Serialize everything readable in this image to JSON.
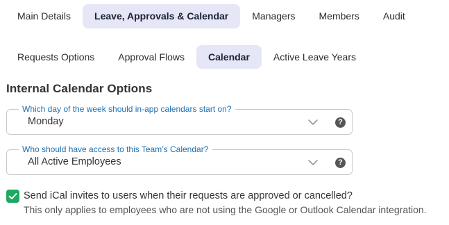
{
  "primary_tabs": [
    {
      "label": "Main Details",
      "active": false
    },
    {
      "label": "Leave, Approvals & Calendar",
      "active": true
    },
    {
      "label": "Managers",
      "active": false
    },
    {
      "label": "Members",
      "active": false
    },
    {
      "label": "Audit",
      "active": false
    }
  ],
  "secondary_tabs": [
    {
      "label": "Requests Options",
      "active": false
    },
    {
      "label": "Approval Flows",
      "active": false
    },
    {
      "label": "Calendar",
      "active": true
    },
    {
      "label": "Active Leave Years",
      "active": false
    }
  ],
  "section_title": "Internal Calendar Options",
  "fields": [
    {
      "label": "Which day of the week should in-app calendars start on?",
      "value": "Monday",
      "help_icon": "?"
    },
    {
      "label": "Who should have access to this Team’s Calendar?",
      "value": "All Active Employees",
      "help_icon": "?"
    }
  ],
  "ical": {
    "checked": true,
    "label": "Send iCal invites to users when their requests are approved or cancelled?",
    "help_text": "This only applies to employees who are not using the Google or Outlook Calendar integration."
  },
  "colors": {
    "active_tab_bg": "#e5e6f6",
    "field_label": "#1e6fb0",
    "checkbox": "#1fa864"
  },
  "icons": [
    "chevron-down-icon",
    "question-circle-icon",
    "checkmark-icon"
  ]
}
